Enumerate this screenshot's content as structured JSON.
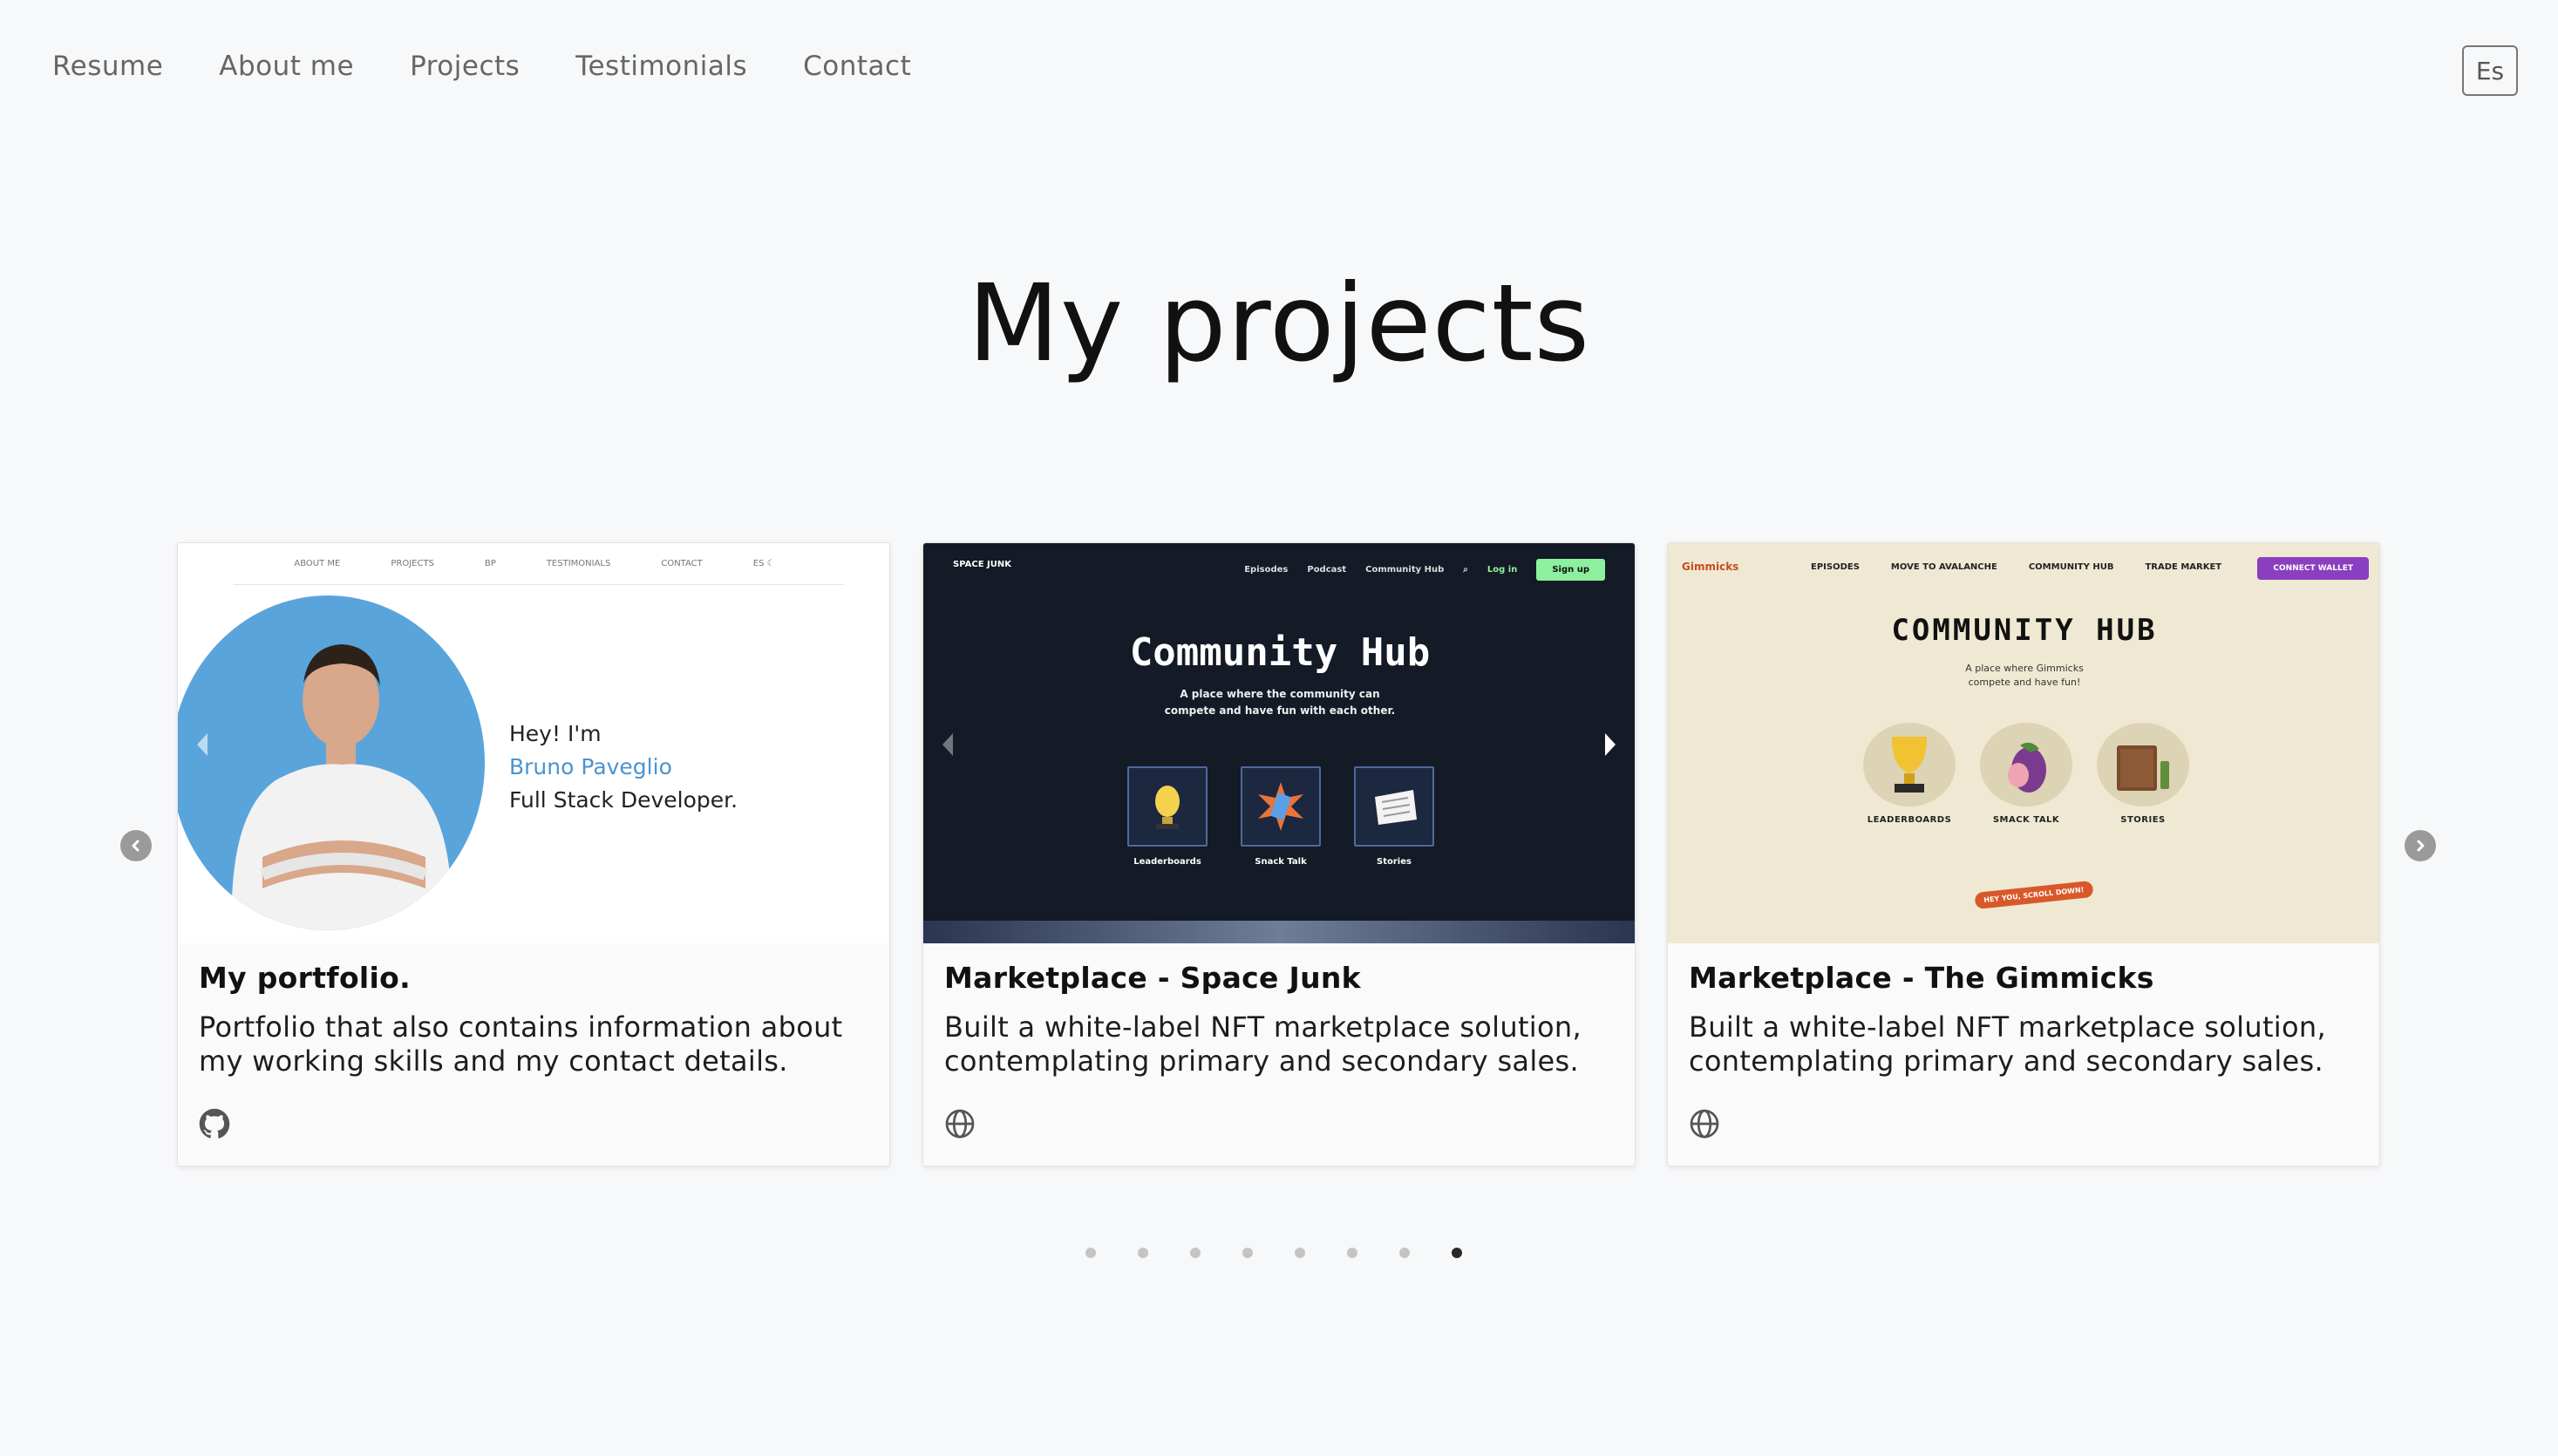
{
  "nav": {
    "items": [
      "Resume",
      "About me",
      "Projects",
      "Testimonials",
      "Contact"
    ],
    "lang_button": "Es"
  },
  "page_title": "My projects",
  "carousel": {
    "prev_icon": "chevron-left-icon",
    "next_icon": "chevron-right-icon",
    "cards": [
      {
        "title": "My portfolio.",
        "description": "Portfolio that also contains information about my working skills and my contact details.",
        "link_icon": "github-icon",
        "preview": {
          "nav": [
            "ABOUT ME",
            "PROJECTS",
            "BP",
            "TESTIMONIALS",
            "CONTACT",
            "ES ☾"
          ],
          "greeting": "Hey! I'm",
          "name": "Bruno Paveglio",
          "role": "Full Stack Developer."
        }
      },
      {
        "title": "Marketplace - Space Junk",
        "description": "Built a white-label NFT marketplace solution, contemplating primary and secondary sales.",
        "link_icon": "globe-icon",
        "preview": {
          "logo": "SPACE JUNK",
          "nav": [
            "Episodes",
            "Podcast",
            "Community Hub"
          ],
          "login": "Log in",
          "signup": "Sign up",
          "title": "Community Hub",
          "subtitle_1": "A place where the community can",
          "subtitle_2": "compete and have fun with each other.",
          "tiles": [
            "Leaderboards",
            "Snack Talk",
            "Stories"
          ]
        }
      },
      {
        "title": "Marketplace - The Gimmicks",
        "description": "Built a white-label NFT marketplace solution, contemplating primary and secondary sales.",
        "link_icon": "globe-icon",
        "preview": {
          "logo": "Gimmicks",
          "nav": [
            "EPISODES",
            "MOVE TO AVALANCHE",
            "COMMUNITY HUB",
            "TRADE MARKET"
          ],
          "connect": "CONNECT WALLET",
          "title": "COMMUNITY HUB",
          "subtitle_1": "A place where Gimmicks",
          "subtitle_2": "compete and have fun!",
          "tiles": [
            "LEADERBOARDS",
            "SMACK TALK",
            "STORIES"
          ],
          "scroll_tag": "HEY YOU, SCROLL DOWN!"
        }
      }
    ],
    "dots_total": 8,
    "active_dot": 7
  }
}
